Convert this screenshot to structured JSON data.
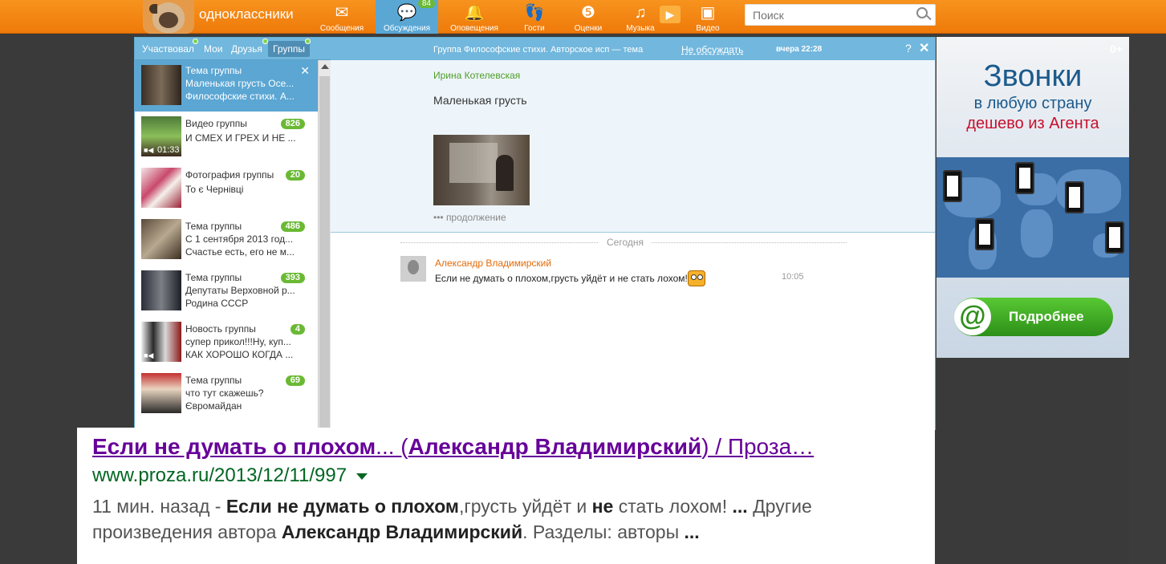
{
  "topbar": {
    "logo_text": "одноклассники",
    "nav": [
      {
        "label": "Сообщения",
        "icon": "envelope-icon"
      },
      {
        "label": "Обсуждения",
        "icon": "chat-bubbles-icon",
        "badge": "84"
      },
      {
        "label": "Оповещения",
        "icon": "bell-icon"
      },
      {
        "label": "Гости",
        "icon": "footprints-icon"
      },
      {
        "label": "Оценки",
        "icon": "rating-five-icon"
      },
      {
        "label": "Музыка",
        "icon": "music-note-icon"
      },
      {
        "label": "Видео",
        "icon": "video-icon"
      }
    ],
    "search_placeholder": "Поиск"
  },
  "tabs": [
    "Участвовал",
    "Мои",
    "Друзья",
    "Группы"
  ],
  "list": [
    {
      "title": "Тема группы",
      "l1": "Маленькая грусть Осе...",
      "l2": "Философские стихи. А...",
      "count": ""
    },
    {
      "title": "Видео группы",
      "l1": "И СМЕХ И ГРЕХ И НЕ ...",
      "l2": "",
      "count": "826",
      "duration": "01:33"
    },
    {
      "title": "Фотография группы",
      "l1": "То є Чернівці",
      "l2": "",
      "count": "20"
    },
    {
      "title": "Тема группы",
      "l1": "С 1 сентября 2013 год...",
      "l2": "Счастье есть, его не м...",
      "count": "486"
    },
    {
      "title": "Тема группы",
      "l1": "Депутаты Верховной р...",
      "l2": "Родина СССР",
      "count": "393"
    },
    {
      "title": "Новость группы",
      "l1": "супер прикол!!!Ну, куп...",
      "l2": "КАК ХОРОШО КОГДА ...",
      "count": "4"
    },
    {
      "title": "Тема группы",
      "l1": "что тут скажешь?",
      "l2": "Євромайдан",
      "count": "69"
    }
  ],
  "chat": {
    "title": "Группа Философские стихи. Авторское исп — тема",
    "unfollow": "Не обсуждать",
    "time": "вчера 22:28",
    "help": "?",
    "close": "✕",
    "post_author": "Ирина Котелевская",
    "post_text": "Маленькая грусть",
    "post_more": "••• продолжение",
    "separator": "Сегодня",
    "msg_author": "Александр Владимирский",
    "msg_text": "Если не думать о плохом,грусть уйдёт и не стать лохом!",
    "msg_time": "10:05"
  },
  "ad": {
    "age": "0+",
    "h1": "Звонки",
    "h2": "в любую страну",
    "h3": "дешево из Агента",
    "button": "Подробнее"
  },
  "result": {
    "title_bold1": "Если не думать о плохом",
    "title_rest1": "... (",
    "title_bold2": "Александр Владимирский",
    "title_rest2": ") / Проза…",
    "url": "www.proza.ru/2013/12/11/997",
    "s_a": "11 мин. назад - ",
    "s_b": "Если не думать о плохом",
    "s_c": ",грусть уйдёт и ",
    "s_d": "не",
    "s_e": " стать лохом! ",
    "s_f": "...",
    "s_g": " Другие",
    "s_h": "произведения автора ",
    "s_i": "Александр Владимирский",
    "s_j": ". Разделы: авторы ",
    "s_k": "..."
  }
}
